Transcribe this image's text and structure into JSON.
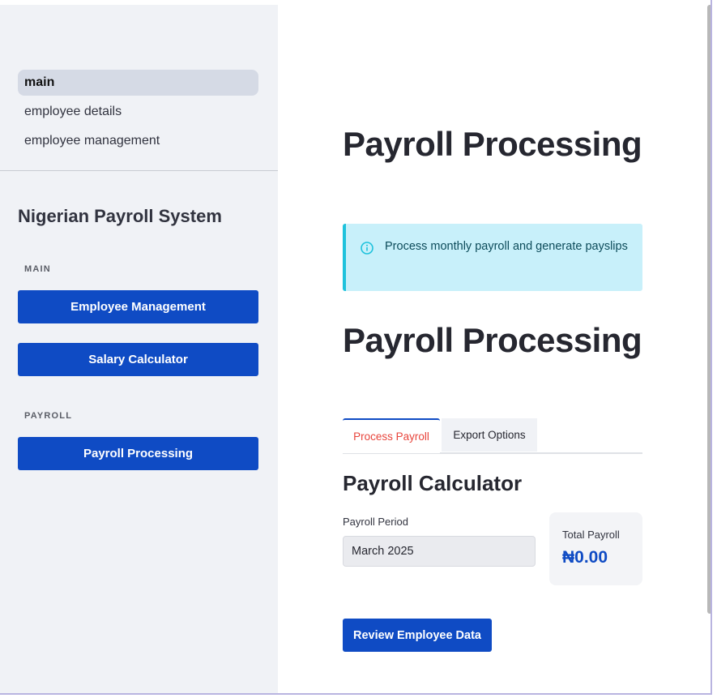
{
  "sidebar": {
    "nav": [
      {
        "label": "main",
        "active": true
      },
      {
        "label": "employee details",
        "active": false
      },
      {
        "label": "employee management",
        "active": false
      }
    ],
    "system_title": "Nigerian Payroll System",
    "section_main": "MAIN",
    "btn_employee_management": "Employee Management",
    "btn_salary_calculator": "Salary Calculator",
    "section_payroll": "PAYROLL",
    "btn_payroll_processing": "Payroll Processing"
  },
  "main": {
    "title": "Payroll Processing",
    "info_text": "Process monthly payroll and generate payslips",
    "info_icon": "info-icon",
    "subtitle": "Payroll Processing",
    "tabs": [
      {
        "label": "Process Payroll",
        "active": true
      },
      {
        "label": "Export Options",
        "active": false
      }
    ],
    "section_title": "Payroll Calculator",
    "period_label": "Payroll Period",
    "period_value": "March 2025",
    "metric_label": "Total Payroll",
    "metric_value": "₦0.00",
    "review_button": "Review Employee Data"
  },
  "colors": {
    "primary": "#0f4bc4",
    "sidebar_bg": "#f0f2f6",
    "info_bg": "#c8f0fa",
    "info_border": "#1ec2dc",
    "active_tab_text": "#e8453c"
  }
}
